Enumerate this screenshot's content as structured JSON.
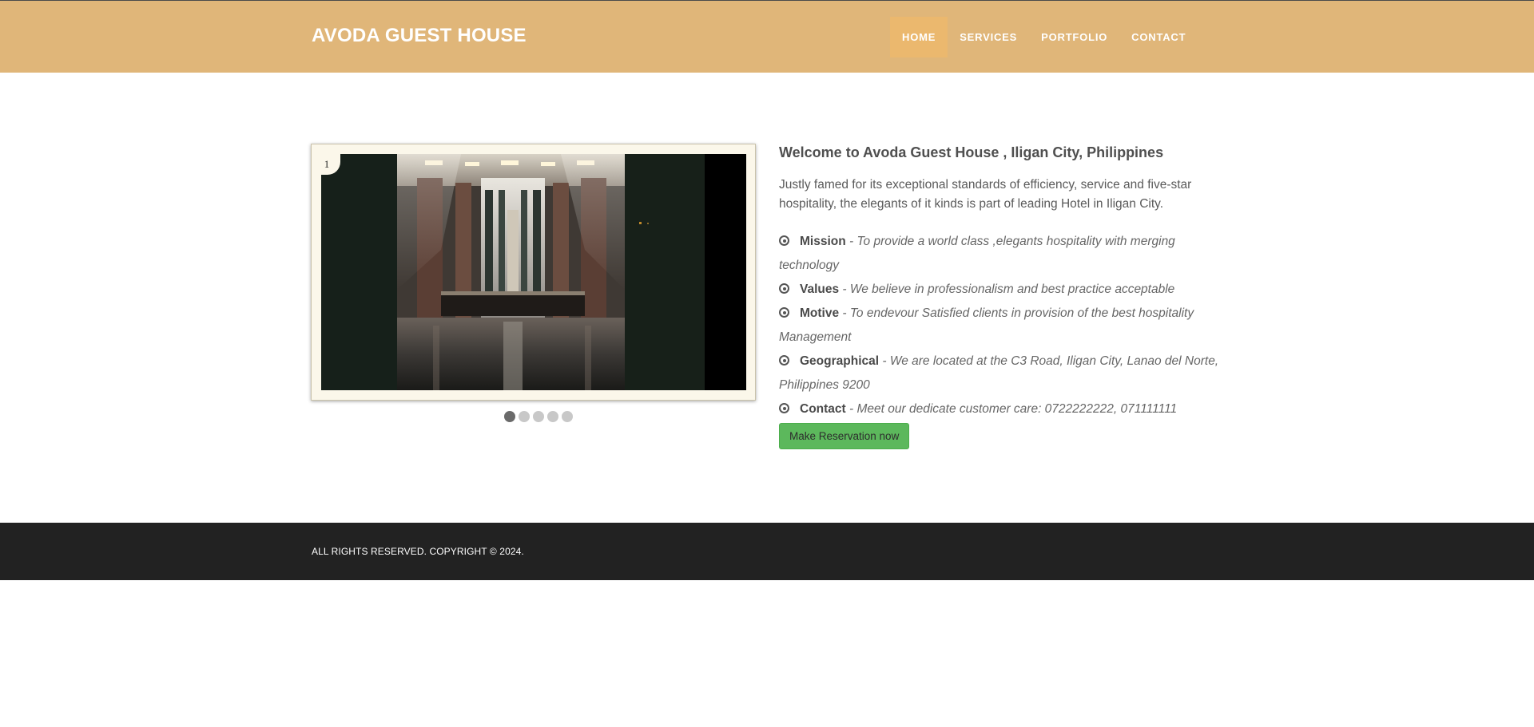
{
  "header": {
    "brand": "AVODA GUEST HOUSE",
    "nav": [
      {
        "label": "HOME",
        "active": true
      },
      {
        "label": "SERVICES",
        "active": false
      },
      {
        "label": "PORTFOLIO",
        "active": false
      },
      {
        "label": "CONTACT",
        "active": false
      }
    ],
    "background_color": "#e0b679",
    "active_tab_color": "#ebb86e"
  },
  "slider": {
    "counter": "1",
    "dots": 5,
    "active_dot": 1,
    "image": "hotel-lobby-interior"
  },
  "content": {
    "title": "Welcome to Avoda Guest House , Iligan City, Philippines",
    "intro": "Justly famed for its exceptional standards of efficiency, service and five-star hospitality, the elegants of it kinds is part of leading Hotel in Iligan City.",
    "features": [
      {
        "label": "Mission",
        "sep": " - ",
        "desc": "To provide a world class ,elegants hospitality with merging technology",
        "icon": "target-icon"
      },
      {
        "label": "Values",
        "sep": " - ",
        "desc": "We believe in professionalism and best practice acceptable",
        "icon": "target-icon"
      },
      {
        "label": "Motive",
        "sep": " - ",
        "desc": "To endevour Satisfied clients in provision of the best hospitality Management",
        "icon": "target-icon"
      },
      {
        "label": "Geographical",
        "sep": " - ",
        "desc": "We are located at the C3 Road, Iligan City, Lanao del Norte, Philippines 9200",
        "icon": "target-icon"
      },
      {
        "label": "Contact",
        "sep": " - ",
        "desc": "Meet our dedicate customer care: 0722222222, 071111111",
        "icon": "target-icon"
      }
    ],
    "reserve_button": "Make Reservation now",
    "button_color": "#5cb85c"
  },
  "footer": {
    "copyright": "ALL RIGHTS RESERVED. COPYRIGHT © 2024.",
    "background_color": "#222222"
  }
}
